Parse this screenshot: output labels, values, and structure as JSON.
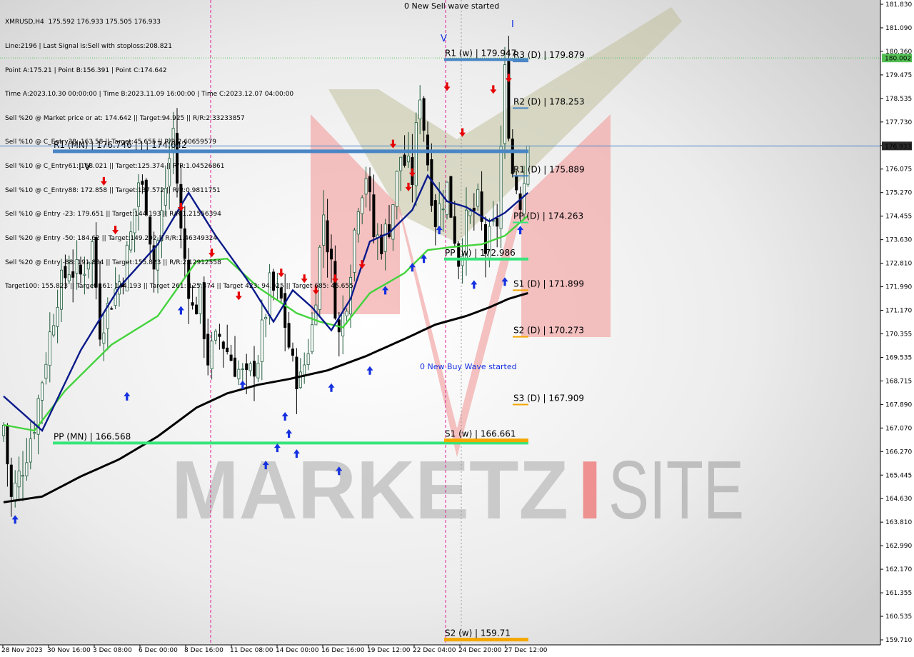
{
  "info": {
    "lines": [
      "XMRUSD,H4  175.592 176.933 175.505 176.933",
      "Line:2196 | Last Signal is:Sell with stoploss:208.821",
      "Point A:175.21 | Point B:156.391 | Point C:174.642",
      "Time A:2023.10.30 00:00:00 | Time B:2023.11.09 16:00:00 | Time C:2023.12.07 04:00:00",
      "Sell %20 @ Market price or at: 174.642 || Target:94.925 || R/R:2.33233857",
      "Sell %10 @ C_Entry38: 163.58 || Target:45.655 || R/R:2.60659579",
      "Sell %10 @ C_Entry61: 168.021 || Target:125.374 || R/R:1.04526861",
      "Sell %10 @ C_Entry88: 172.858 || Target:137.572 || R/R:0.9811751",
      "Sell %10 @ Entry -23: 179.651 || Target:144.193 || R/R:1.21556394",
      "Sell %20 @ Entry -50: 184.62 || Target:149.202 || R/R:1.46349324",
      "Sell %20 @ Entry -88: 191.884 || Target:155.823 || R/R:2.12912558",
      "Target100: 155.823 || Target 161: 144.193 || Target 261: 125.374 || Target 423: 94.925 || Target 685: 45.655"
    ]
  },
  "annotations": {
    "sell_wave": "0 New Sell wave started",
    "buy_wave": "0 New Buy Wave started",
    "wave_iv": "I V",
    "wave_v": "V",
    "wave_i": "I"
  },
  "watermark": {
    "left": "MARKETZ",
    "right": "SITE",
    "separator": "I"
  },
  "current_price_label": "176.933",
  "green_level_label": "180.002",
  "colors": {
    "bg_edge": "#d4d4d4",
    "bg_center": "#ffffff",
    "bull_candle": "#1f5b3a",
    "bear_candle": "#000000",
    "ma_fast": "#0a1a8a",
    "ma_mid": "#44d33c",
    "ma_slow": "#000000",
    "pivot_blue": "#4a86c5",
    "pivot_green": "#37e57a",
    "pivot_orange": "#f5a700",
    "sell_arrow": "#e60000",
    "buy_arrow": "#1530e0",
    "vline": "#e0209a",
    "price_line": "#4a86c5",
    "shape_red": "#f1a1a1",
    "shape_olive": "#b7b98f"
  },
  "chart_data": {
    "type": "candlestick",
    "symbol": "XMRUSD",
    "timeframe": "H4",
    "ohlc_last": {
      "open": 175.592,
      "high": 176.933,
      "low": 175.505,
      "close": 176.933
    },
    "ylim": [
      159.7,
      181.9
    ],
    "y_ticks": [
      "181.830",
      "181.090",
      "180.360",
      "179.475",
      "178.535",
      "177.730",
      "176.933",
      "176.075",
      "175.270",
      "174.455",
      "173.630",
      "172.810",
      "171.990",
      "171.170",
      "170.355",
      "169.535",
      "168.715",
      "167.890",
      "167.070",
      "166.270",
      "165.445",
      "164.630",
      "163.810",
      "162.990",
      "162.170",
      "161.355",
      "160.535",
      "159.710"
    ],
    "x_ticks": [
      "28 Nov 2023",
      "30 Nov 16:00",
      "3 Dec 08:00",
      "6 Dec 00:00",
      "8 Dec 16:00",
      "11 Dec 08:00",
      "14 Dec 00:00",
      "16 Dec 16:00",
      "19 Dec 12:00",
      "22 Dec 04:00",
      "24 Dec 20:00",
      "27 Dec 12:00"
    ],
    "pivot_levels": [
      {
        "label": "R1 (MN) | 176.746 | | | 174.642",
        "value": 176.746,
        "style": "blue"
      },
      {
        "label": "PP (MN) | 166.568",
        "value": 166.568,
        "style": "green"
      },
      {
        "label": "R1 (w) | 179.947",
        "value": 179.947,
        "style": "blue"
      },
      {
        "label": "PP (w) | 172.986",
        "value": 172.986,
        "style": "green"
      },
      {
        "label": "S1 (w) | 166.661",
        "value": 166.661,
        "style": "orange"
      },
      {
        "label": "S2 (w) | 159.71",
        "value": 159.71,
        "style": "orange"
      },
      {
        "label": "R3 (D) | 179.879",
        "value": 179.879,
        "style": "blue"
      },
      {
        "label": "R2 (D) | 178.253",
        "value": 178.253,
        "style": "blue"
      },
      {
        "label": "R1 (D) | 175.889",
        "value": 175.889,
        "style": "blue"
      },
      {
        "label": "PP (D) | 174.263",
        "value": 174.263,
        "style": "green"
      },
      {
        "label": "S1 (D) | 171.899",
        "value": 171.899,
        "style": "orange"
      },
      {
        "label": "S2 (D) | 170.273",
        "value": 170.273,
        "style": "orange"
      },
      {
        "label": "S3 (D) | 167.909",
        "value": 167.909,
        "style": "orange"
      }
    ],
    "current_price": 176.933,
    "green_level": 180.002,
    "anchor_closes": [
      [
        0,
        167.2
      ],
      [
        2,
        164.6
      ],
      [
        5,
        165.8
      ],
      [
        8,
        167.3
      ],
      [
        11,
        169.6
      ],
      [
        14,
        171.8
      ],
      [
        17,
        172.7
      ],
      [
        20,
        172.4
      ],
      [
        23,
        173.5
      ],
      [
        25,
        170.6
      ],
      [
        28,
        171.6
      ],
      [
        31,
        172.5
      ],
      [
        33,
        173.8
      ],
      [
        35,
        175.7
      ],
      [
        37,
        175.0
      ],
      [
        39,
        172.7
      ],
      [
        41,
        174.5
      ],
      [
        44,
        177.5
      ],
      [
        46,
        173.9
      ],
      [
        49,
        171.2
      ],
      [
        51,
        171.6
      ],
      [
        53,
        169.5
      ],
      [
        56,
        170.3
      ],
      [
        60,
        169.3
      ],
      [
        63,
        168.7
      ],
      [
        66,
        169.6
      ],
      [
        69,
        172.0
      ],
      [
        72,
        171.5
      ],
      [
        75,
        169.2
      ],
      [
        77,
        168.7
      ],
      [
        80,
        170.6
      ],
      [
        83,
        174.6
      ],
      [
        85,
        172.6
      ],
      [
        87,
        170.3
      ],
      [
        89,
        171.7
      ],
      [
        92,
        175.1
      ],
      [
        94,
        176.0
      ],
      [
        96,
        173.8
      ],
      [
        98,
        173.6
      ],
      [
        100,
        174.2
      ],
      [
        103,
        176.6
      ],
      [
        106,
        175.8
      ],
      [
        108,
        178.9
      ],
      [
        110,
        176.4
      ],
      [
        112,
        174.4
      ],
      [
        115,
        175.5
      ],
      [
        118,
        173.0
      ],
      [
        120,
        174.2
      ],
      [
        123,
        174.9
      ],
      [
        125,
        173.3
      ],
      [
        128,
        174.3
      ],
      [
        130,
        179.4
      ],
      [
        132,
        176.0
      ],
      [
        134,
        175.1
      ],
      [
        136,
        176.5
      ]
    ],
    "ma_fast": [
      [
        0,
        168.2
      ],
      [
        10,
        167.0
      ],
      [
        20,
        169.8
      ],
      [
        30,
        172.0
      ],
      [
        40,
        173.5
      ],
      [
        48,
        175.3
      ],
      [
        55,
        173.8
      ],
      [
        63,
        172.3
      ],
      [
        70,
        170.8
      ],
      [
        75,
        171.9
      ],
      [
        80,
        171.3
      ],
      [
        85,
        170.5
      ],
      [
        90,
        171.6
      ],
      [
        95,
        173.6
      ],
      [
        100,
        173.9
      ],
      [
        106,
        174.7
      ],
      [
        110,
        175.9
      ],
      [
        115,
        175.0
      ],
      [
        120,
        174.8
      ],
      [
        126,
        174.3
      ],
      [
        130,
        174.6
      ],
      [
        136,
        175.3
      ]
    ],
    "ma_mid": [
      [
        0,
        167.2
      ],
      [
        8,
        167.0
      ],
      [
        16,
        168.4
      ],
      [
        28,
        170.0
      ],
      [
        40,
        171.0
      ],
      [
        50,
        172.9
      ],
      [
        58,
        173.0
      ],
      [
        66,
        172.0
      ],
      [
        76,
        171.1
      ],
      [
        82,
        170.8
      ],
      [
        88,
        170.6
      ],
      [
        95,
        171.8
      ],
      [
        104,
        172.5
      ],
      [
        110,
        173.3
      ],
      [
        116,
        173.4
      ],
      [
        124,
        173.5
      ],
      [
        130,
        173.8
      ],
      [
        136,
        174.5
      ]
    ],
    "ma_slow": [
      [
        0,
        164.5
      ],
      [
        10,
        164.7
      ],
      [
        20,
        165.4
      ],
      [
        30,
        166.0
      ],
      [
        40,
        166.8
      ],
      [
        50,
        167.8
      ],
      [
        58,
        168.3
      ],
      [
        66,
        168.6
      ],
      [
        74,
        168.8
      ],
      [
        84,
        169.1
      ],
      [
        94,
        169.6
      ],
      [
        104,
        170.2
      ],
      [
        112,
        170.7
      ],
      [
        120,
        171.0
      ],
      [
        126,
        171.3
      ],
      [
        131,
        171.6
      ],
      [
        136,
        171.8
      ]
    ],
    "sell_signals": [
      [
        26,
        175.7
      ],
      [
        29,
        174.0
      ],
      [
        46,
        174.8
      ],
      [
        54,
        173.2
      ],
      [
        61,
        171.7
      ],
      [
        72,
        172.5
      ],
      [
        78,
        172.3
      ],
      [
        81,
        171.9
      ],
      [
        86,
        172.3
      ],
      [
        93,
        172.8
      ],
      [
        101,
        177.0
      ],
      [
        105,
        175.5
      ],
      [
        106,
        176.0
      ],
      [
        115,
        179.0
      ],
      [
        119,
        177.4
      ],
      [
        127,
        178.9
      ],
      [
        131,
        179.3
      ]
    ],
    "buy_signals": [
      [
        3,
        163.9
      ],
      [
        32,
        168.2
      ],
      [
        46,
        171.2
      ],
      [
        62,
        168.6
      ],
      [
        68,
        165.8
      ],
      [
        71,
        166.4
      ],
      [
        73,
        167.5
      ],
      [
        74,
        166.9
      ],
      [
        76,
        166.2
      ],
      [
        85,
        168.5
      ],
      [
        87,
        165.6
      ],
      [
        95,
        169.1
      ],
      [
        99,
        171.9
      ],
      [
        106,
        172.7
      ],
      [
        109,
        173.0
      ],
      [
        113,
        174.0
      ],
      [
        122,
        172.1
      ],
      [
        130,
        172.2
      ],
      [
        134,
        174.0
      ]
    ]
  }
}
